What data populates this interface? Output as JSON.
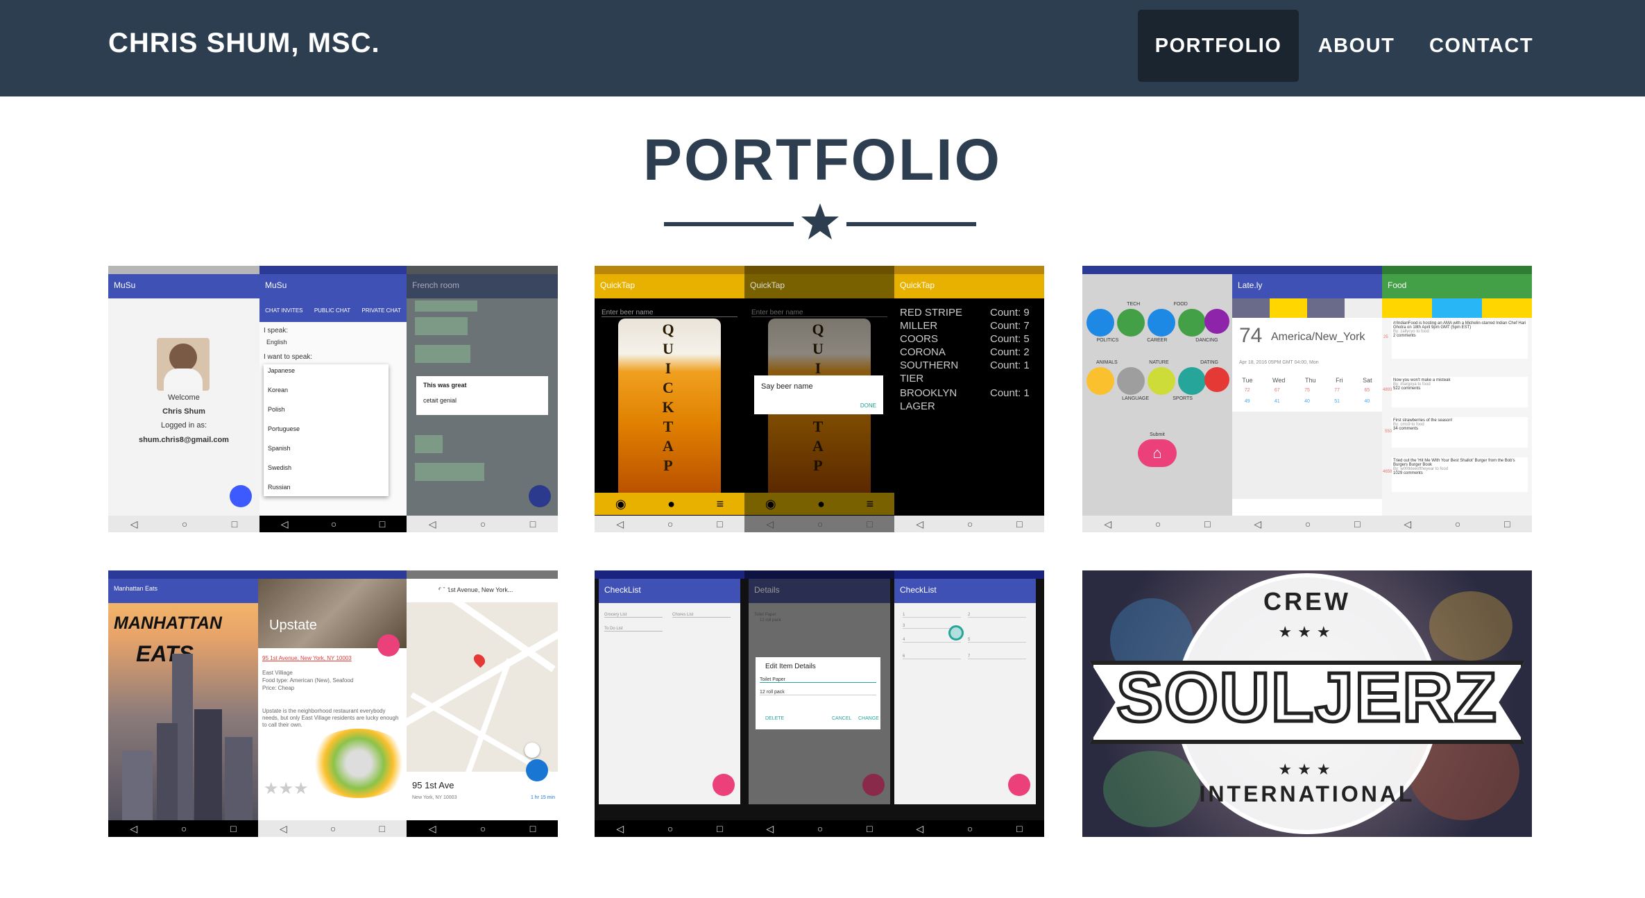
{
  "navbar": {
    "brand": "CHRIS SHUM, MSC.",
    "links": [
      "PORTFOLIO",
      "ABOUT",
      "CONTACT"
    ]
  },
  "section": {
    "title": "PORTFOLIO"
  },
  "colors": {
    "navbar": "#2c3e50",
    "active_link": "#1a252f",
    "title": "#2c3e50"
  },
  "items": [
    {
      "id": "musu",
      "app_title": "MuSu",
      "tabs": [
        "CHAT INVITES",
        "PUBLIC CHAT",
        "PRIVATE CHAT"
      ],
      "welcome": "Welcome",
      "user": "Chris Shum",
      "logged_in": "Logged in as:",
      "email": "shum.chris8@gmail.com",
      "i_speak": "I speak:",
      "english": "English",
      "i_want": "I want to speak:",
      "languages": [
        "Japanese",
        "Korean",
        "Polish",
        "Portuguese",
        "Spanish",
        "Swedish",
        "Russian"
      ],
      "room": "French room",
      "dialog_title": "This was great",
      "dialog_text": "cetait genial"
    },
    {
      "id": "quicktap",
      "app_title": "QuickTap",
      "placeholder": "Enter beer name",
      "vertical": "QUICKTAP",
      "dialog": "Say beer name",
      "done": "DONE",
      "beers": [
        {
          "name": "RED STRIPE",
          "count": "Count: 9"
        },
        {
          "name": "MILLER",
          "count": "Count: 7"
        },
        {
          "name": "COORS",
          "count": "Count: 5"
        },
        {
          "name": "CORONA",
          "count": "Count: 2"
        },
        {
          "name": "SOUTHERN TIER",
          "count": "Count: 1"
        },
        {
          "name": "BROOKLYN LAGER",
          "count": "Count: 1"
        }
      ]
    },
    {
      "id": "lately",
      "app_title": "Late.ly",
      "food_title": "Food",
      "cats": [
        "TECH",
        "FOOD",
        "POLITICS",
        "CAREER",
        "DANCING",
        "ANIMALS",
        "NATURE",
        "DATING",
        "LANGUAGE",
        "SPORTS"
      ],
      "submit": "Submit",
      "temp": "74",
      "city": "America/New_York",
      "date": "Apr 18, 2016 05PM GMT 04:00, Mon",
      "days": [
        "Tue",
        "Wed",
        "Thu",
        "Fri",
        "Sat"
      ],
      "highs": [
        "72",
        "67",
        "75",
        "77",
        "65"
      ],
      "lows": [
        "49",
        "41",
        "40",
        "51",
        "40"
      ],
      "posts": [
        {
          "text": "/r/IndianFood is hosting an AMA with a Michelin-starred Indian Chef Hari Ghotra on 18th April 9pm GMT (5pm EST)",
          "by": "By: zallycyo to food",
          "comments": "2 comments",
          "score": "25"
        },
        {
          "text": "Now you won't make a misteak",
          "by": "By: margoya to food",
          "comments": "522 comments",
          "score": "4893"
        },
        {
          "text": "First strawberries of the season!",
          "by": "By: cms9 to food",
          "comments": "34 comments",
          "score": "550"
        },
        {
          "text": "Tried out the 'Hit Me With Your Best Shallot' Burger from the Bob's Burgers Burger Book",
          "by": "By: w00tkleeoftheyear to food",
          "comments": "1029 comments",
          "score": "4658"
        }
      ]
    },
    {
      "id": "manhattan",
      "app_title": "Manhattan Eats",
      "title_line1": "MANHATTAN",
      "title_line2": "EATS",
      "place": "Upstate",
      "address": "95 1st Avenue, New York, NY 10003",
      "info1": "East Villiage",
      "info2": "Food type: American (New), Seafood",
      "info3": "Price: Cheap",
      "desc": "Upstate is the neighborhood restaurant everybody needs, but only East Village residents are lucky enough to call their own.",
      "search": "95 1st Avenue, New York...",
      "map_addr": "95 1st Ave",
      "map_sub": "New York, NY 10003",
      "eta": "1 hr 15 min"
    },
    {
      "id": "checklist",
      "app_title": "CheckList",
      "details": "Details",
      "lists": [
        "Grocery List",
        "Chores List",
        "To Do List"
      ],
      "dialog_title": "Edit Item Details",
      "field1": "Toilet Paper",
      "field2": "12 roll pack",
      "btn_delete": "DELETE",
      "btn_cancel": "CANCEL",
      "btn_change": "CHANGE",
      "nums": [
        "1",
        "2",
        "3",
        "4",
        "5",
        "6",
        "7"
      ]
    },
    {
      "id": "souljerz",
      "top": "CREW",
      "main": "SOULJERZ",
      "bottom": "INTERNATIONAL"
    }
  ]
}
